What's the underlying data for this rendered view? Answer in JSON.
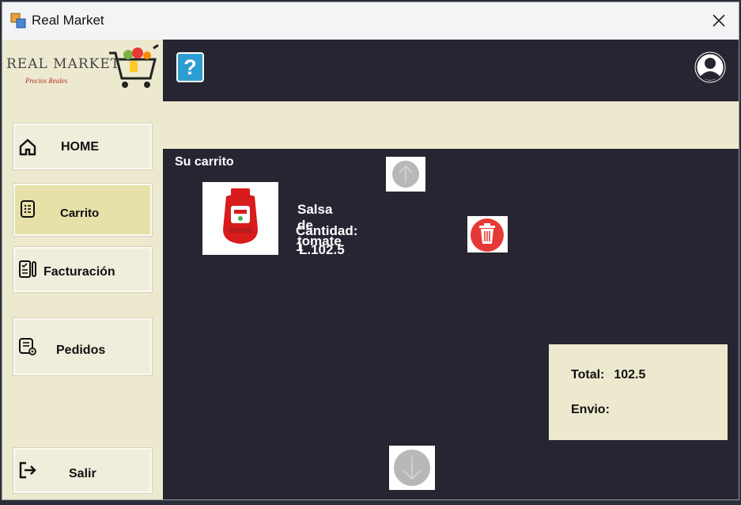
{
  "window": {
    "title": "Real Market"
  },
  "sidebar": {
    "logo": {
      "brand": "REAL MARKET",
      "tagline": "Precios Reales"
    },
    "items": [
      {
        "label": "HOME",
        "icon": "home-icon",
        "active": false
      },
      {
        "label": "Carrito",
        "icon": "cart-list-icon",
        "active": true
      },
      {
        "label": "Facturación",
        "icon": "invoice-icon",
        "active": false
      },
      {
        "label": "Pedidos",
        "icon": "orders-icon",
        "active": false
      },
      {
        "label": "Salir",
        "icon": "logout-icon",
        "active": false
      }
    ]
  },
  "topbar": {
    "help_label": "?"
  },
  "cart": {
    "title": "Su carrito",
    "items": [
      {
        "name": "Salsa de tomate",
        "quantity_text": "Cantidad: 1",
        "price_text": "L.102.5"
      }
    ]
  },
  "summary": {
    "total_label": "Total:",
    "total_value": "102.5",
    "shipping_label": "Envio:",
    "shipping_value": ""
  },
  "colors": {
    "sidebar_bg": "#ede9cf",
    "main_bg": "#262531",
    "active_nav": "#e6e1a8",
    "delete_red": "#e53935",
    "help_blue": "#2e9ed2"
  }
}
